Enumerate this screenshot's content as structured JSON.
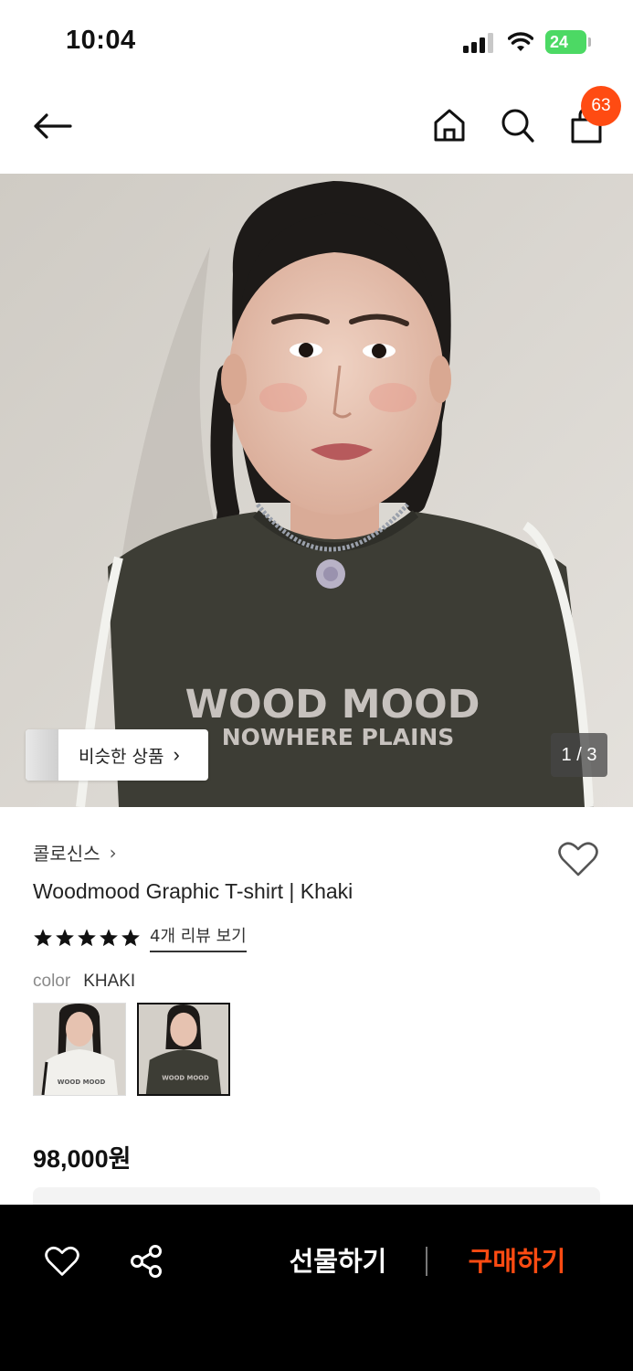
{
  "status_bar": {
    "time": "10:04",
    "battery": "24"
  },
  "nav": {
    "cart_count": "63"
  },
  "hero": {
    "similar_label": "비슷한 상품",
    "page_indicator": "1 / 3",
    "shirt_text_line1": "WOOD MOOD",
    "shirt_text_line2": "NOWHERE PLAINS"
  },
  "product": {
    "brand": "콜로신스",
    "name": "Woodmood Graphic T-shirt | Khaki",
    "rating_stars": 5,
    "review_link": "4개 리뷰 보기",
    "color_label": "color",
    "color_value": "KHAKI",
    "swatch_text": "WOOD MOOD",
    "price": "98,000원"
  },
  "bottom_bar": {
    "gift_label": "선물하기",
    "buy_label": "구매하기"
  },
  "colors": {
    "accent": "#ff4b12",
    "shirt_khaki": "#3d3d35",
    "background": "#ffffff"
  }
}
